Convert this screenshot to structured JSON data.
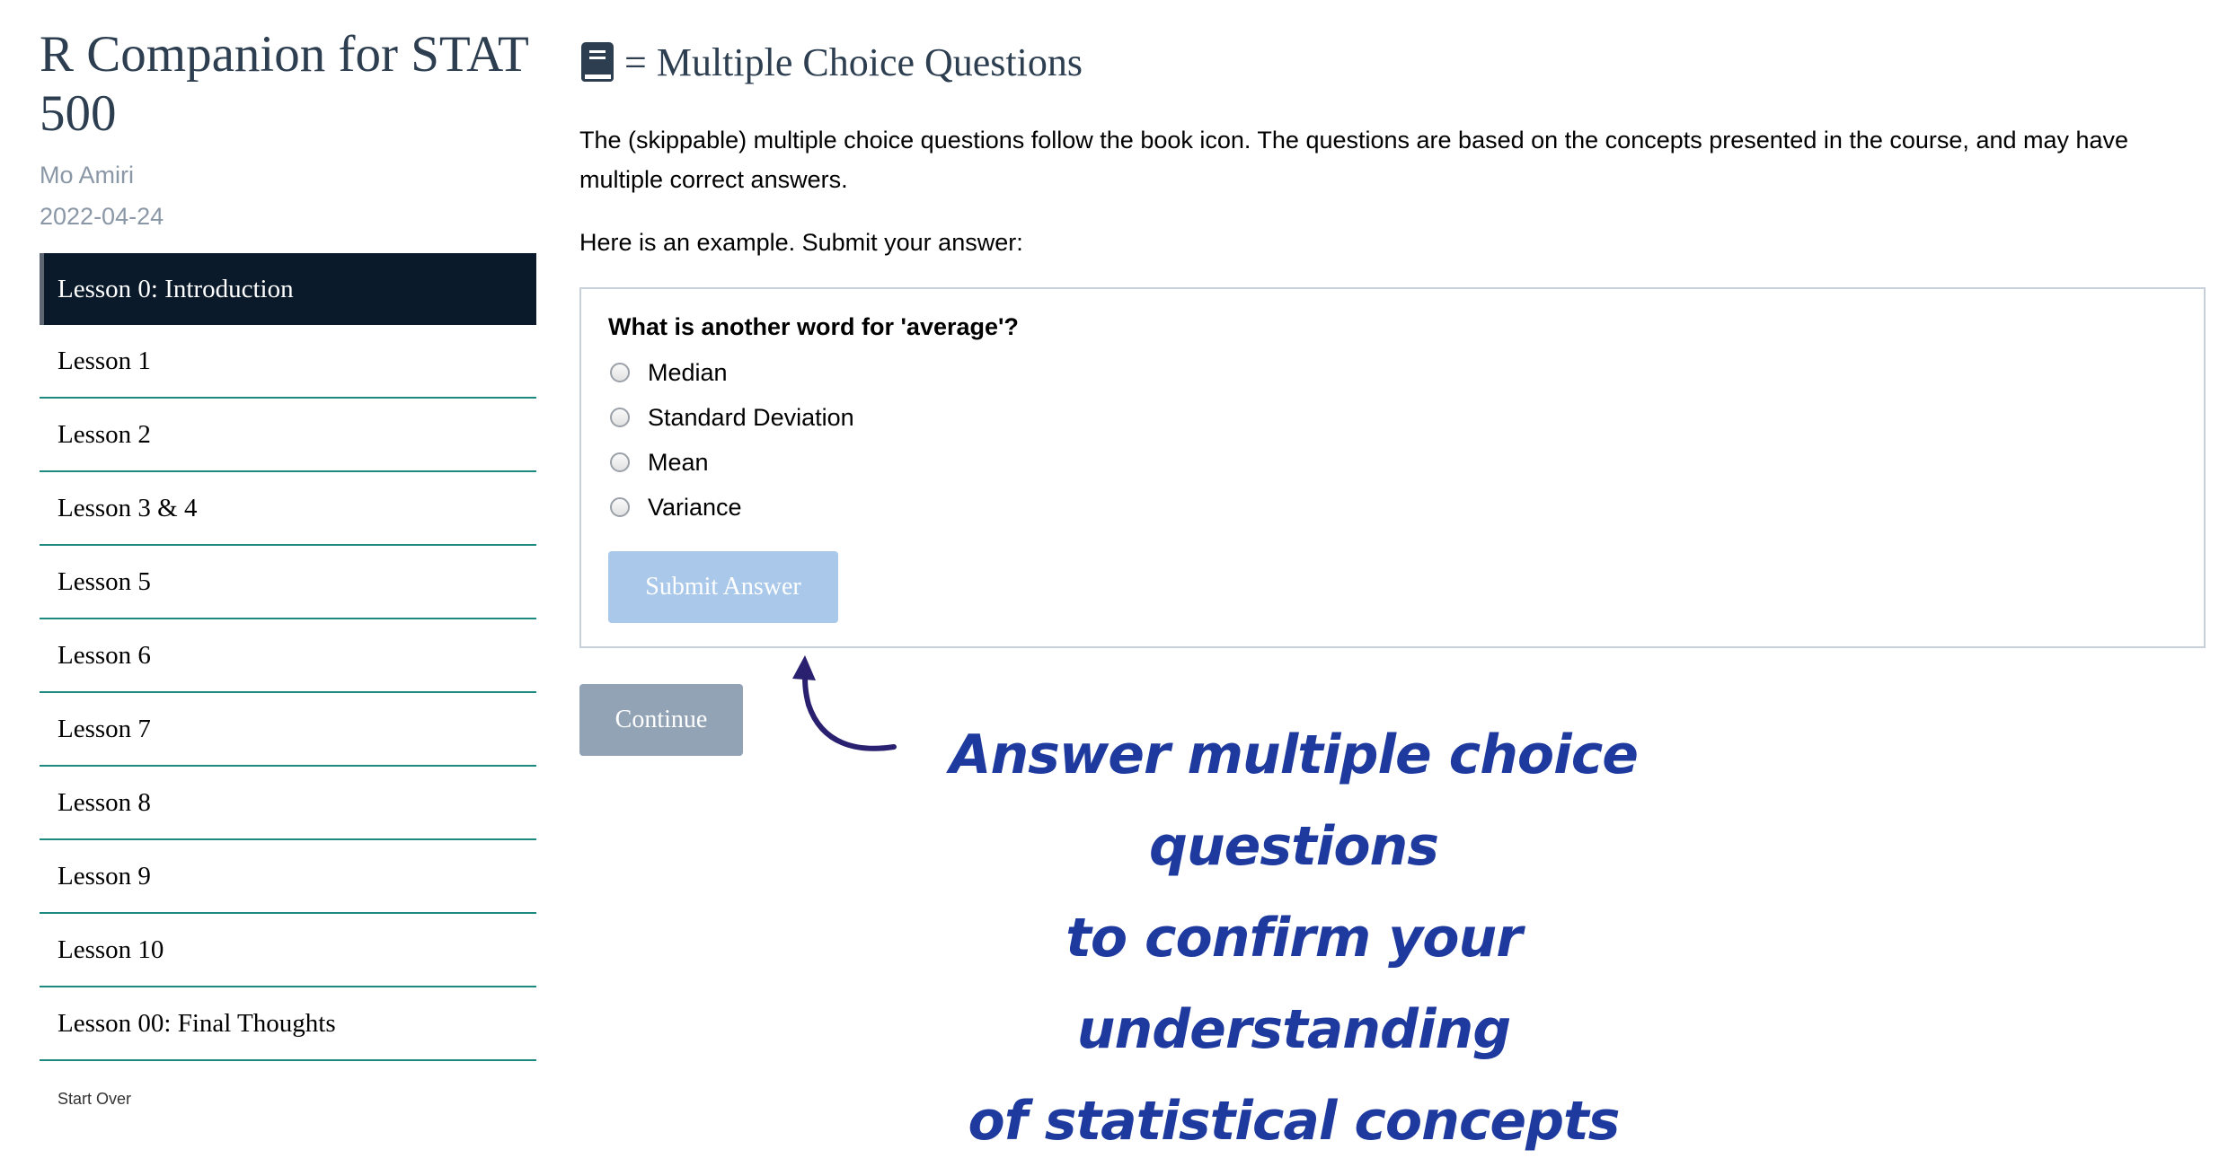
{
  "sidebar": {
    "title": "R Companion for STAT 500",
    "author": "Mo Amiri",
    "date": "2022-04-24",
    "lessons": [
      {
        "label": "Lesson 0: Introduction",
        "active": true
      },
      {
        "label": "Lesson 1"
      },
      {
        "label": "Lesson 2"
      },
      {
        "label": "Lesson 3 & 4"
      },
      {
        "label": "Lesson 5"
      },
      {
        "label": "Lesson 6"
      },
      {
        "label": "Lesson 7"
      },
      {
        "label": "Lesson 8"
      },
      {
        "label": "Lesson 9"
      },
      {
        "label": "Lesson 10"
      },
      {
        "label": "Lesson 00: Final Thoughts"
      }
    ],
    "start_over": "Start Over"
  },
  "main": {
    "section_title": "= Multiple Choice Questions",
    "section_icon": "book-icon",
    "intro": "The (skippable) multiple choice questions follow the book icon. The questions are based on the concepts presented in the course, and may have multiple correct answers.",
    "prompt": "Here is an example. Submit your answer:",
    "quiz": {
      "question": "What is another word for 'average'?",
      "options": [
        "Median",
        "Standard Deviation",
        "Mean",
        "Variance"
      ],
      "submit_label": "Submit Answer"
    },
    "continue_label": "Continue"
  },
  "annotation": {
    "lines": [
      "Answer multiple choice questions",
      "to confirm your understanding",
      "of statistical concepts"
    ],
    "color": "#1e3a9e"
  },
  "colors": {
    "active_lesson_bg": "#0b1a2a",
    "lesson_divider": "#1d8a80",
    "title": "#2c3e50",
    "submit_bg": "#a9c8ea",
    "continue_bg": "#92a3b6"
  }
}
